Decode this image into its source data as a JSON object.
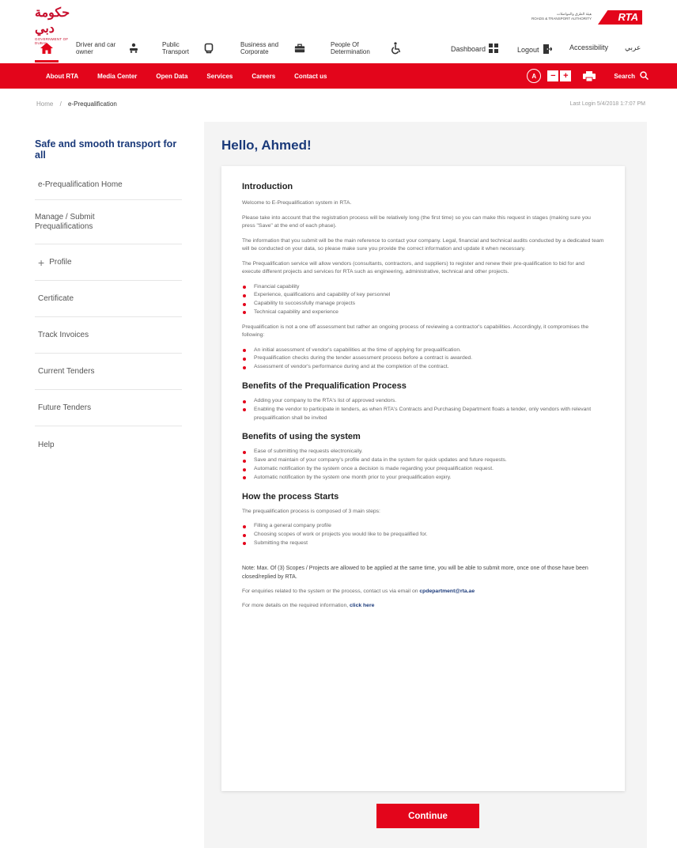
{
  "header": {
    "gov_logo_script": "حكومة دبي",
    "gov_logo_text": "GOVERNMENT OF DUBAI",
    "rta_logo_text_ar": "هيئة الطرق والمواصلات",
    "rta_logo_text_en": "ROADS & TRANSPORT AUTHORITY",
    "rta_logo_mark": "RTA"
  },
  "user_nav": {
    "items": [
      {
        "label": "Driver and car owner",
        "icon": "driver-car-icon"
      },
      {
        "label": "Public Transport",
        "icon": "public-transport-icon"
      },
      {
        "label": "Business and Corporate",
        "icon": "briefcase-icon"
      },
      {
        "label": "People Of Determination",
        "icon": "wheelchair-icon"
      }
    ],
    "dashboard": "Dashboard",
    "logout": "Logout",
    "accessibility": "Accessibility",
    "arabic": "عربي"
  },
  "menu": {
    "items": [
      "About RTA",
      "Media Center",
      "Open Data",
      "Services",
      "Careers",
      "Contact us"
    ],
    "contrast_label": "A",
    "zoom_out": "−",
    "zoom_in": "+",
    "search": "Search"
  },
  "breadcrumb": {
    "home": "Home",
    "separator": "/",
    "current": "e-Prequalification",
    "last_login": "Last Login 5/4/2018 1:7:07 PM"
  },
  "sidebar": {
    "tagline": "Safe and smooth transport for all",
    "items": [
      "e-Prequalification Home",
      "Manage / Submit Prequalifications",
      "Profile",
      "Certificate",
      "Track Invoices",
      "Current Tenders",
      "Future Tenders",
      "Help"
    ]
  },
  "main": {
    "greeting": "Hello, Ahmed!",
    "intro_title": "Introduction",
    "intro_p1": "Welcome to E-Prequalification system in RTA.",
    "intro_p2": "Please take into account that the registration process will be relatively long (the first time) so you can make this request in stages (making sure you press \"Save\" at the end of each phase).",
    "intro_p3": "The information that you submit will be the main reference to contact your company. Legal, financial and technical audits conducted by a dedicated team will be conducted on your data, so please make sure you provide the correct information and update it when necessary.",
    "intro_p4": "The Prequalification service will allow vendors (consultants, contractors, and suppliers) to register and renew their pre-qualification to bid for and execute different projects and services for RTA such as engineering, administrative, technical and other projects.",
    "intro_list": [
      "Financial capability",
      "Experience, qualifications and capability of key personnel",
      "Capability to successfully manage projects",
      "Technical capability and experience"
    ],
    "intro_p5": "Prequalification is not a one off assessment but rather an ongoing process of reviewing a contractor's capabilities. Accordingly, it compromises the following:",
    "process_list": [
      "An initial assessment of vendor's capabilities at the time of applying for prequalification.",
      "Prequalification checks during the tender assessment process before a contract is awarded.",
      "Assessment of vendor's performance during and at the completion of the contract."
    ],
    "benefits_process_title": "Benefits of the Prequalification Process",
    "benefits_process_list": [
      "Adding your company to the RTA's list of approved vendors.",
      "Enabling the vendor to participate in tenders, as when RTA's Contracts and Purchasing Department floats a tender, only vendors with relevant prequalification shall be invited"
    ],
    "benefits_system_title": "Benefits of using the system",
    "benefits_system_list": [
      "Ease of submitting the requests electronically.",
      "Save and maintain of your company's profile and data in the system for quick updates and future requests.",
      "Automatic notification by the system once a decision is made regarding your prequalification request.",
      "Automatic notification by the system one month prior to your prequalification expiry."
    ],
    "how_title": "How the process Starts",
    "how_intro": "The prequalification process is composed of 3 main steps:",
    "how_list": [
      "Filling a general company profile",
      "Choosing scopes of work or projects you would like to be prequalified for.",
      "Submitting the request"
    ],
    "note": "Note: Max. Of (3) Scopes / Projects are allowed to be applied at the same time, you will be able to submit more, once one of those have been closed/replied by RTA.",
    "enquiries_text": "For enquiries related to the system or the process, contact us via email on",
    "enquiries_email": "cpdepartment@rta.ae",
    "details_text": "For more details on the required information,",
    "details_link": "click here",
    "continue_label": "Continue"
  },
  "colors": {
    "brand_red": "#e3051b",
    "brand_blue": "#1b3a7a",
    "panel_bg": "#f4f4f4"
  }
}
